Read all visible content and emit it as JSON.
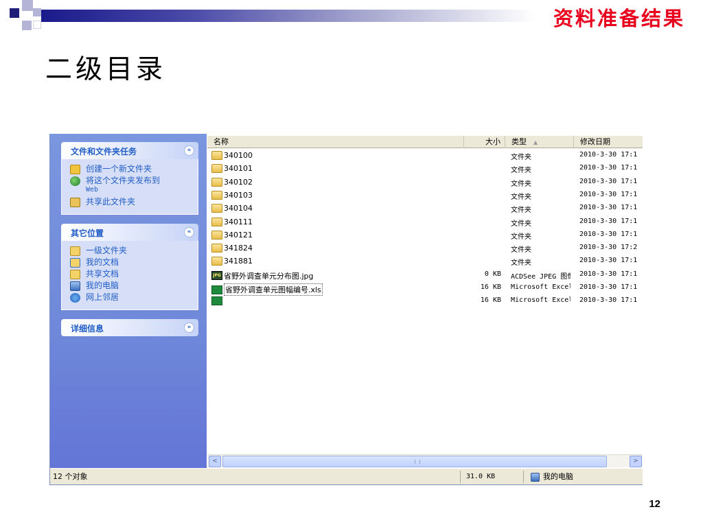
{
  "slide": {
    "heading": "资料准备结果",
    "title": "二级目录",
    "page_number": "12"
  },
  "colors": {
    "heading": "#e8001c",
    "taskpane_bg": "#6f88d9",
    "link": "#215dc6"
  },
  "taskpane": {
    "sections": [
      {
        "title": "文件和文件夹任务",
        "chevron": "«",
        "items": [
          {
            "label": "创建一个新文件夹",
            "icon": "new-folder-icon"
          },
          {
            "label": "将这个文件夹发布到",
            "label2": "Web",
            "icon": "publish-web-icon"
          },
          {
            "label": "共享此文件夹",
            "icon": "share-folder-icon"
          }
        ]
      },
      {
        "title": "其它位置",
        "chevron": "«",
        "items": [
          {
            "label": "一级文件夹",
            "icon": "folder-icon"
          },
          {
            "label": "我的文档",
            "icon": "my-documents-icon"
          },
          {
            "label": "共享文档",
            "icon": "shared-documents-icon"
          },
          {
            "label": "我的电脑",
            "icon": "my-computer-icon"
          },
          {
            "label": "网上邻居",
            "icon": "network-icon"
          }
        ]
      },
      {
        "title": "详细信息",
        "chevron": "»",
        "items": []
      }
    ]
  },
  "filelist": {
    "columns": {
      "name": "名称",
      "size": "大小",
      "type": "类型",
      "date": "修改日期",
      "sort_indicator": "▲"
    },
    "rows": [
      {
        "icon": "folder",
        "name": "340100",
        "size": "",
        "type": "文件夹",
        "date": "2010-3-30 17:1"
      },
      {
        "icon": "folder",
        "name": "340101",
        "size": "",
        "type": "文件夹",
        "date": "2010-3-30 17:1"
      },
      {
        "icon": "folder",
        "name": "340102",
        "size": "",
        "type": "文件夹",
        "date": "2010-3-30 17:1"
      },
      {
        "icon": "folder",
        "name": "340103",
        "size": "",
        "type": "文件夹",
        "date": "2010-3-30 17:1"
      },
      {
        "icon": "folder",
        "name": "340104",
        "size": "",
        "type": "文件夹",
        "date": "2010-3-30 17:1"
      },
      {
        "icon": "folder",
        "name": "340111",
        "size": "",
        "type": "文件夹",
        "date": "2010-3-30 17:1"
      },
      {
        "icon": "folder",
        "name": "340121",
        "size": "",
        "type": "文件夹",
        "date": "2010-3-30 17:1"
      },
      {
        "icon": "folder",
        "name": "341824",
        "size": "",
        "type": "文件夹",
        "date": "2010-3-30 17:2"
      },
      {
        "icon": "folder",
        "name": "341881",
        "size": "",
        "type": "文件夹",
        "date": "2010-3-30 17:1"
      },
      {
        "icon": "jpg",
        "icon_text": "JPG",
        "name": "省野外调查单元分布图.jpg",
        "size": "0 KB",
        "type": "ACDSee JPEG 图像",
        "date": "2010-3-30 17:1"
      },
      {
        "icon": "xls",
        "name": "省野外调查单元图幅编号.xls",
        "size": "16 KB",
        "type": "Microsoft Excel...",
        "date": "2010-3-30 17:1"
      },
      {
        "icon": "xls",
        "name": "",
        "size": "16 KB",
        "type": "Microsoft Excel...",
        "date": "2010-3-30 17:1"
      }
    ]
  },
  "scrollbar": {
    "left": "<",
    "right": ">"
  },
  "statusbar": {
    "count": "12 个对象",
    "size": "31.0 KB",
    "zone": "我的电脑"
  }
}
